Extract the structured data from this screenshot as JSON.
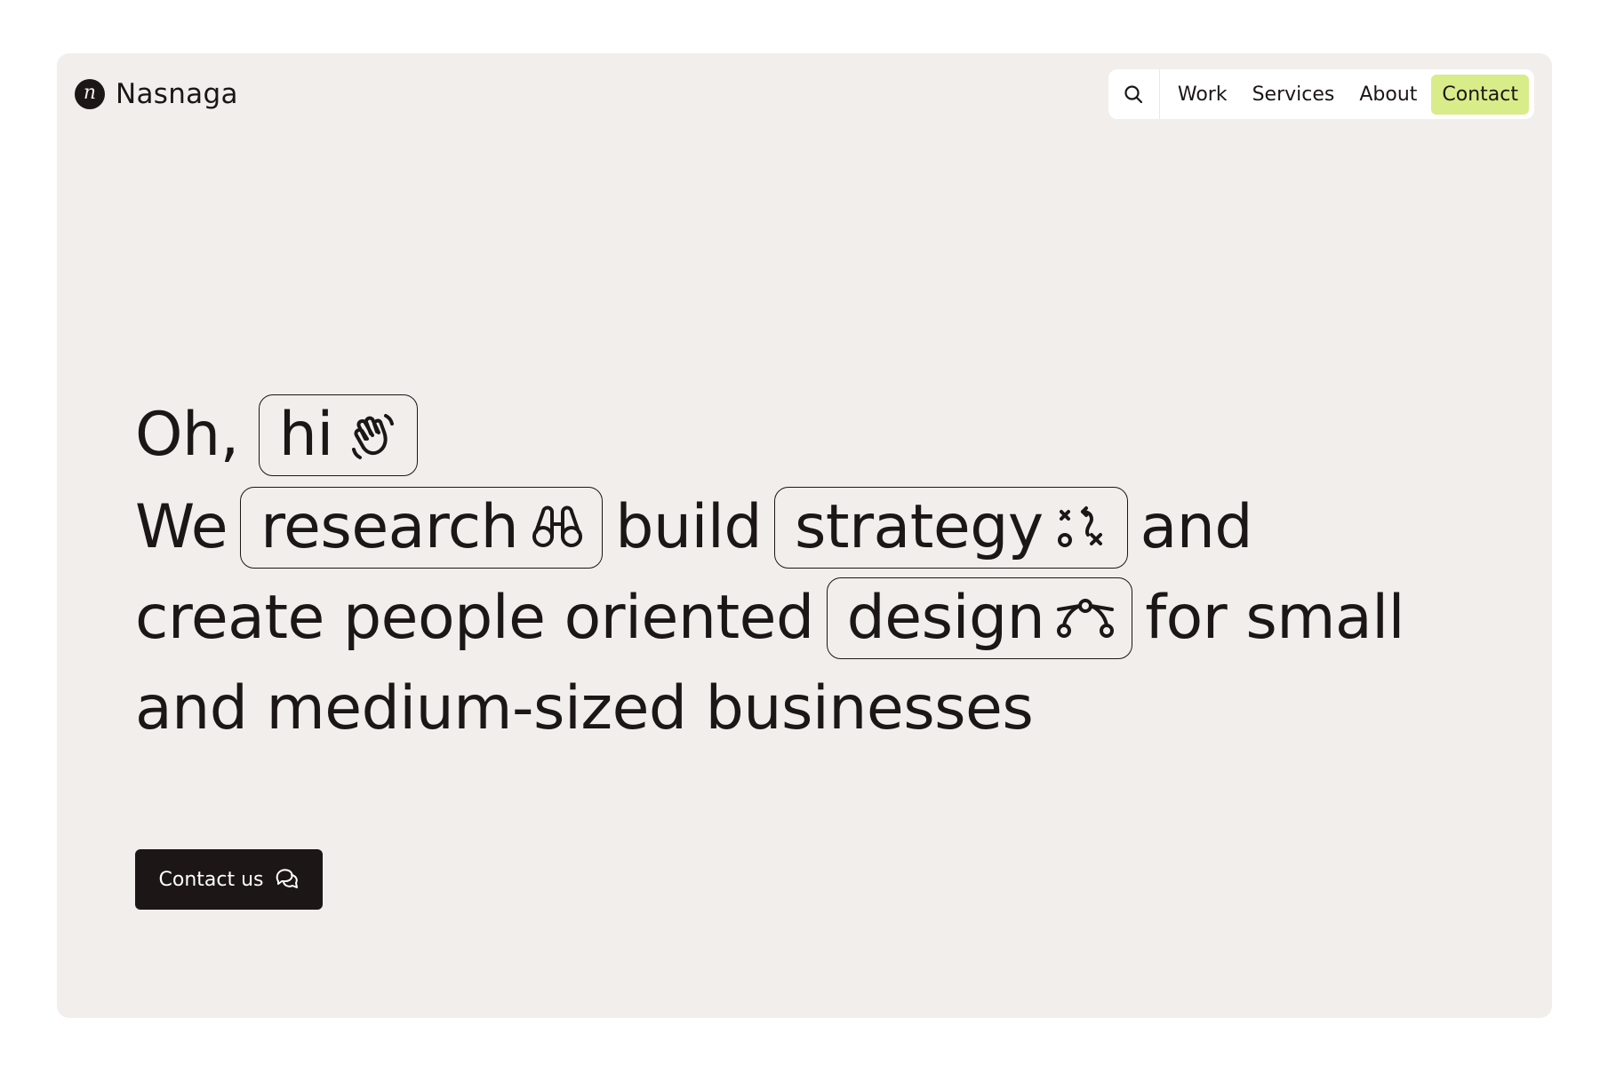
{
  "brand": {
    "logo_letter": "n",
    "name": "Nasnaga"
  },
  "nav": {
    "search_icon": "search-icon",
    "items": [
      {
        "label": "Work"
      },
      {
        "label": "Services"
      },
      {
        "label": "About"
      },
      {
        "label": "Contact",
        "accent": "#d8ec8a"
      }
    ]
  },
  "hero": {
    "line1": {
      "prefix": "Oh,",
      "pill": "hi",
      "pill_icon": "waving-hand-icon"
    },
    "line2": {
      "w1": "We",
      "pill1": "research",
      "pill1_icon": "binoculars-icon",
      "w2": "build",
      "pill2": "strategy",
      "pill2_icon": "strategy-play-icon",
      "w3": "and"
    },
    "line3": {
      "w1": "create people oriented",
      "pill": "design",
      "pill_icon": "bezier-curve-icon",
      "w2": "for small"
    },
    "line4": "and medium-sized businesses"
  },
  "cta": {
    "label": "Contact us",
    "icon": "chat-bubbles-icon"
  },
  "colors": {
    "background": "#ffffff",
    "panel": "#f1eeeb",
    "ink": "#1c1616",
    "accent": "#d8ec8a"
  }
}
